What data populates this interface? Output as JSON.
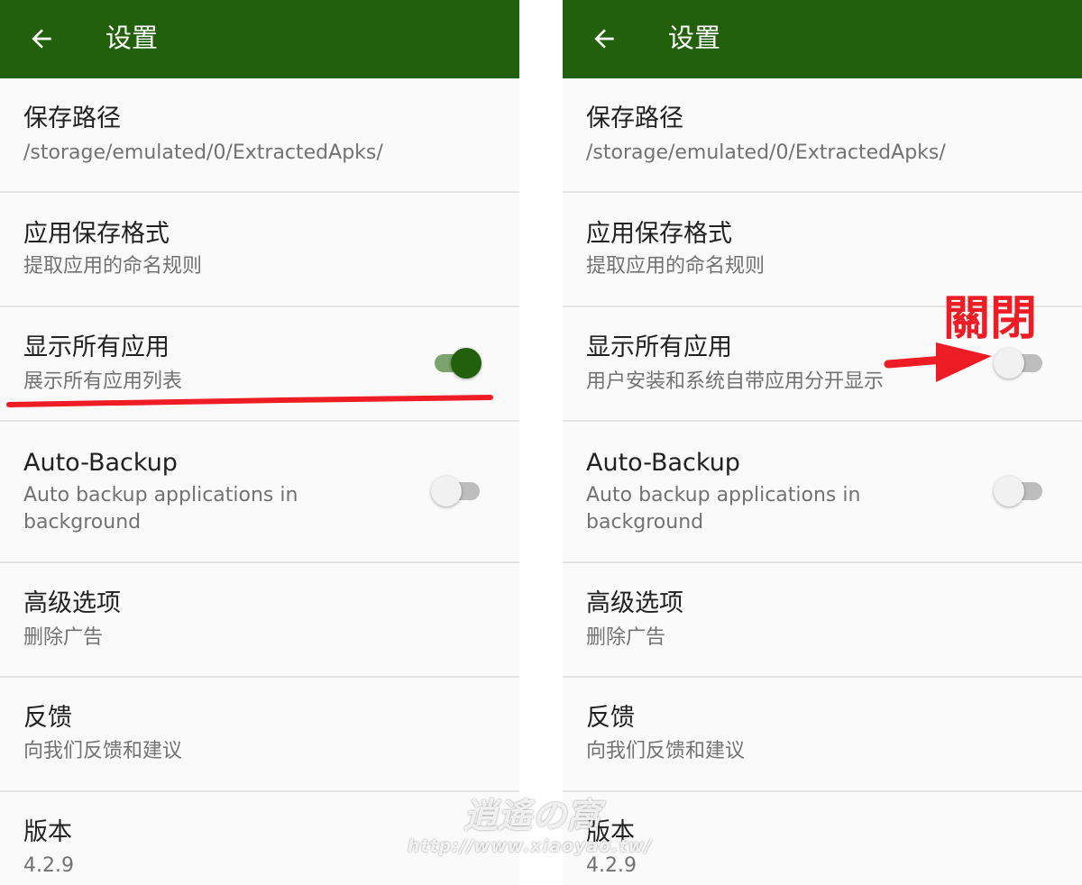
{
  "colors": {
    "appbar": "#22600b",
    "switch_on": "#22600b",
    "annotation": "#ee1c24"
  },
  "left": {
    "appbar": {
      "back_icon": "arrow-left-icon",
      "title": "设置"
    },
    "items": [
      {
        "title": "保存路径",
        "summary": "/storage/emulated/0/ExtractedApks/"
      },
      {
        "title": "应用保存格式",
        "summary": "提取应用的命名规则"
      },
      {
        "title": "显示所有应用",
        "summary": "展示所有应用列表",
        "switch": "on"
      },
      {
        "title": "Auto-Backup",
        "summary": "Auto backup applications in background",
        "switch": "off"
      },
      {
        "title": "高级选项",
        "summary": "删除广告"
      },
      {
        "title": "反馈",
        "summary": "向我们反馈和建议"
      },
      {
        "title": "版本",
        "summary": "4.2.9"
      }
    ]
  },
  "right": {
    "appbar": {
      "back_icon": "arrow-left-icon",
      "title": "设置"
    },
    "items": [
      {
        "title": "保存路径",
        "summary": "/storage/emulated/0/ExtractedApks/"
      },
      {
        "title": "应用保存格式",
        "summary": "提取应用的命名规则"
      },
      {
        "title": "显示所有应用",
        "summary": "用户安装和系统自带应用分开显示",
        "switch": "off"
      },
      {
        "title": "Auto-Backup",
        "summary": "Auto backup applications in background",
        "switch": "off"
      },
      {
        "title": "高级选项",
        "summary": "删除广告"
      },
      {
        "title": "反馈",
        "summary": "向我们反馈和建议"
      },
      {
        "title": "版本",
        "summary": "4.2.9"
      }
    ]
  },
  "annotation": {
    "label": "關閉"
  },
  "watermark": {
    "title": "逍遙の窩",
    "url": "http://www.xiaoyao.tw/"
  }
}
